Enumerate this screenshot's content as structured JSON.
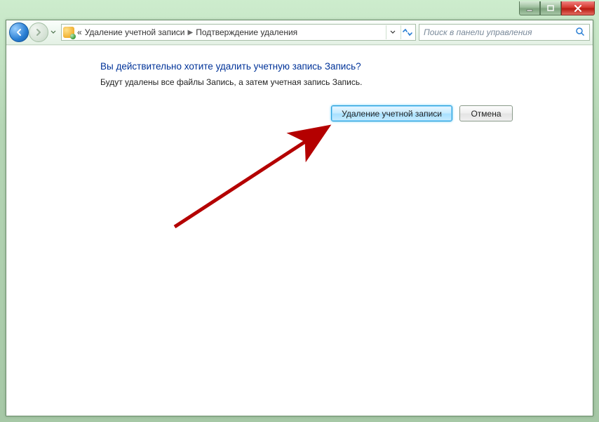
{
  "breadcrumb": {
    "prefix": "«",
    "item1": "Удаление учетной записи",
    "item2": "Подтверждение удаления"
  },
  "search": {
    "placeholder": "Поиск в панели управления"
  },
  "content": {
    "heading": "Вы действительно хотите удалить учетную запись Запись?",
    "subtext": "Будут удалены все файлы Запись, а затем учетная запись Запись."
  },
  "buttons": {
    "delete": "Удаление учетной записи",
    "cancel": "Отмена"
  }
}
